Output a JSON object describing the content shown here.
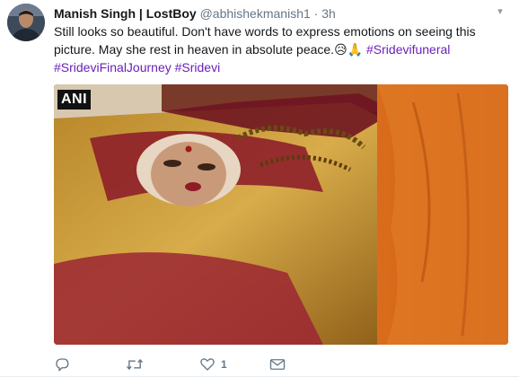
{
  "tweet": {
    "author_name": "Manish Singh | LostBoy",
    "handle": "@abhishekmanish1",
    "separator": "·",
    "time": "3h",
    "text_part1": "Still looks so beautiful. Don't have words to express emotions on seeing this picture. May she rest in heaven in absolute peace.",
    "emoji_sad": "😥",
    "emoji_pray": "🙏",
    "hashtags": [
      "#Sridevifuneral",
      "#SrideviFinalJourney",
      "#Sridevi"
    ],
    "hashtag_color": "#6a1fb8",
    "media_watermark": "ANI",
    "caret_icon": "chevron-down-icon"
  },
  "actions": {
    "reply_icon": "reply-icon",
    "retweet_icon": "retweet-icon",
    "like_icon": "heart-icon",
    "like_count": "1",
    "dm_icon": "envelope-icon"
  }
}
